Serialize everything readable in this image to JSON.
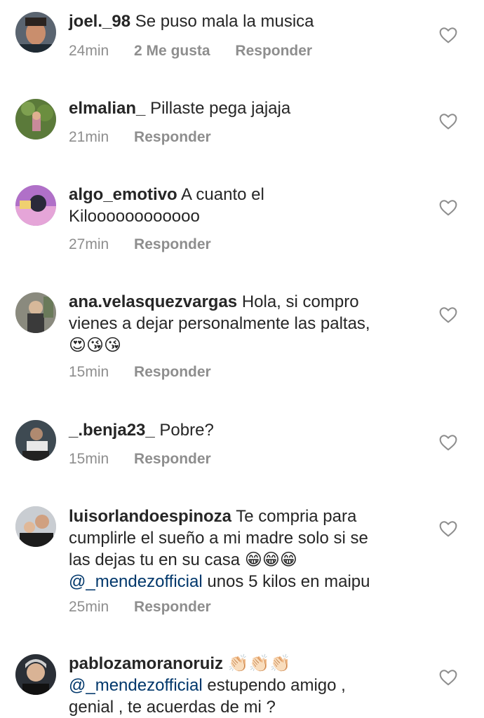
{
  "comments": [
    {
      "username": "joel._98",
      "text": "Se puso mala la musica",
      "time": "24min",
      "likes": "2 Me gusta",
      "reply": "Responder"
    },
    {
      "username": "elmalian_",
      "text": "Pillaste pega jajaja",
      "time": "21min",
      "reply": "Responder"
    },
    {
      "username": "algo_emotivo",
      "text": "A cuanto el",
      "text2": "Kiloooooooooooo",
      "time": "27min",
      "reply": "Responder"
    },
    {
      "username": "ana.velasquezvargas",
      "text": "Hola, si  compro",
      "text2": "vienes a dejar personalmente las paltas,",
      "emojis": "😍😘😘",
      "time": "15min",
      "reply": "Responder"
    },
    {
      "username": "_.benja23_",
      "text": "Pobre?",
      "time": "15min",
      "reply": "Responder"
    },
    {
      "username": "luisorlandoespinoza",
      "text": "Te compria para",
      "text2": "cumplirle el sueño a mi madre solo si se",
      "text3": "las dejas tu en su casa",
      "emojis": "😁😁😁",
      "mention": "@_mendezofficial",
      "text4": "unos 5 kilos en maipu",
      "time": "25min",
      "reply": "Responder"
    },
    {
      "username": "pablozamoranoruiz",
      "emojis": "👏🏻👏🏻👏🏻",
      "mention": "@_mendezofficial",
      "text": "estupendo amigo ,",
      "text2": "genial , te acuerdas de mi ?"
    }
  ],
  "colors": {
    "text": "#262626",
    "meta": "#8e8e8e",
    "mention": "#00376b",
    "heart": "#8e8e8e"
  },
  "icons": {
    "like": "heart-outline-icon"
  }
}
